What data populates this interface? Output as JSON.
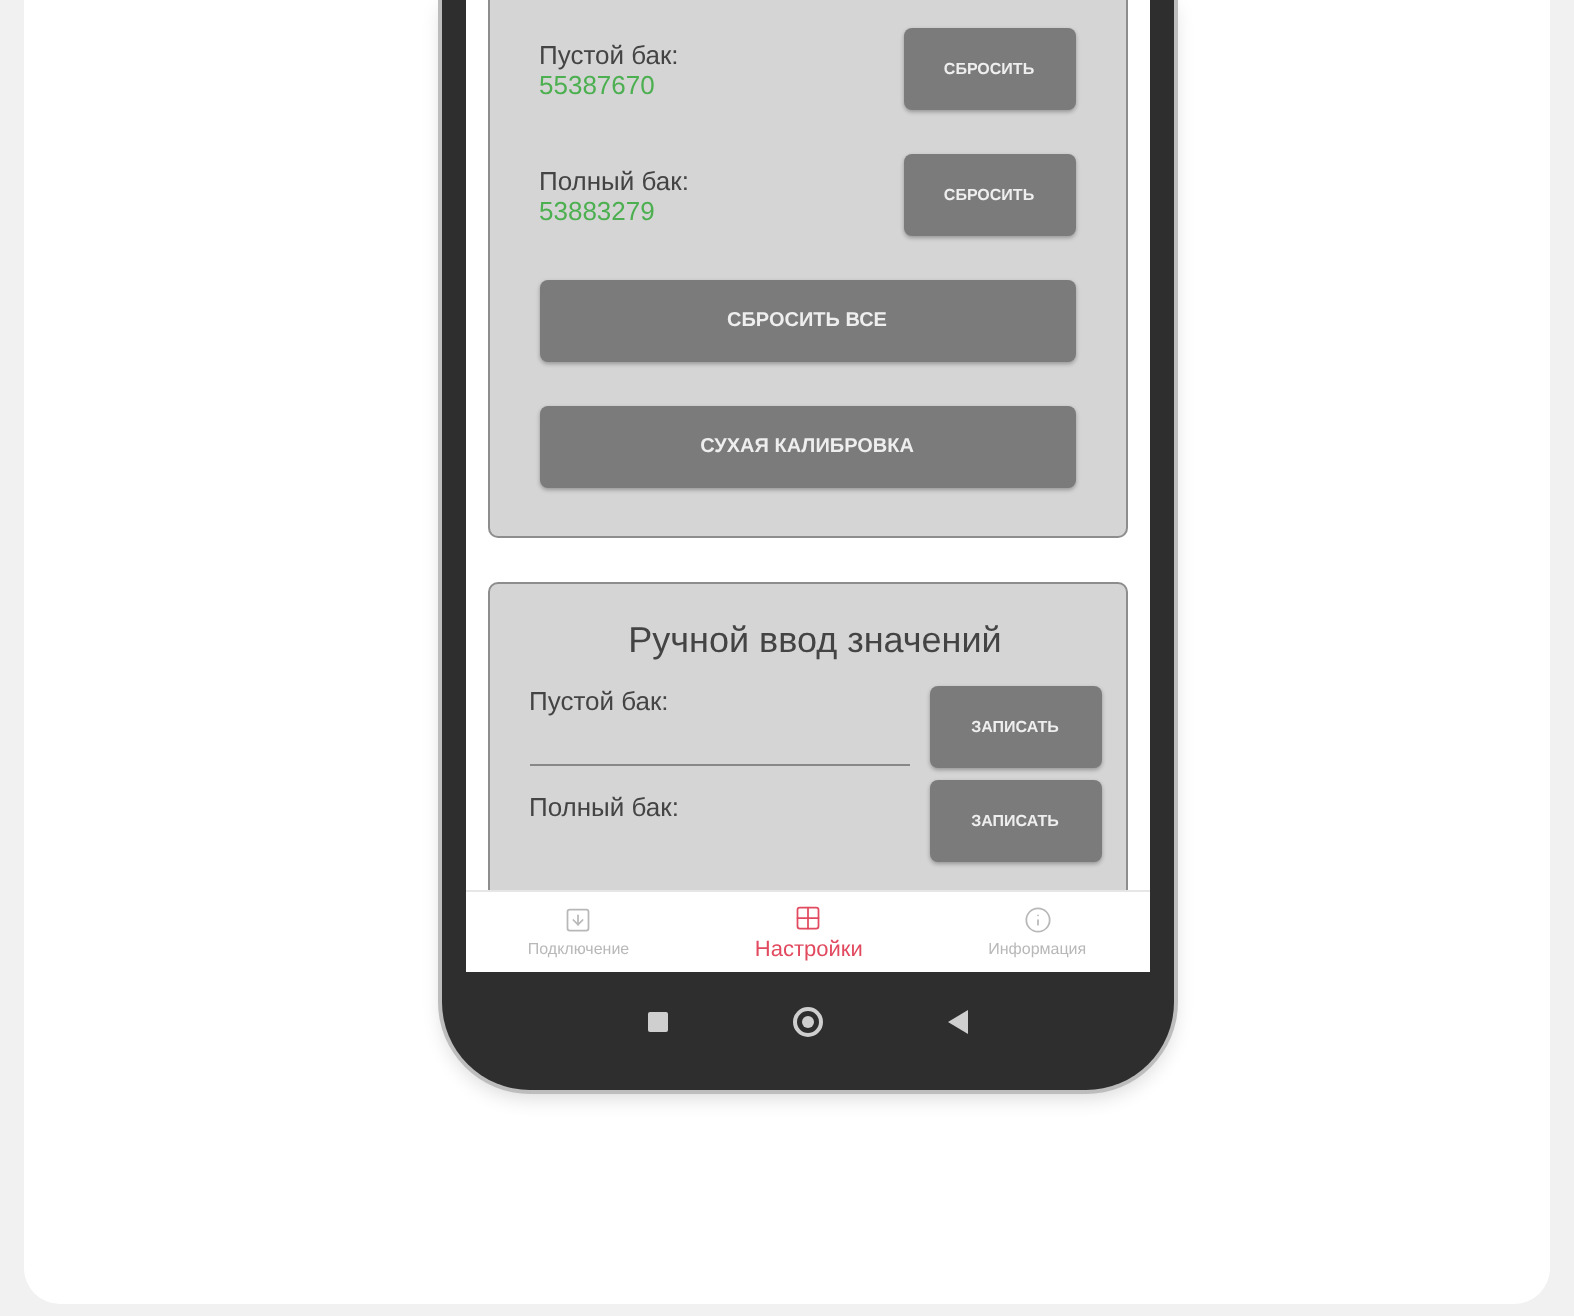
{
  "calibration": {
    "rows": [
      {
        "label": "Пустой бак:",
        "value": "55387670",
        "button": "СБРОСИТЬ"
      },
      {
        "label": "Полный бак:",
        "value": "53883279",
        "button": "СБРОСИТЬ"
      }
    ],
    "actions": [
      "СБРОСИТЬ ВСЕ",
      "СУХАЯ КАЛИБРОВКА"
    ]
  },
  "manual_entry": {
    "title": "Ручной ввод значений",
    "rows": [
      {
        "label": "Пустой бак:",
        "button": "ЗАПИСАТЬ",
        "kind": "field"
      },
      {
        "label": "Полный бак:",
        "button": "ЗАПИСАТЬ",
        "kind": "cut"
      }
    ]
  },
  "tabs": [
    {
      "label": "Подключение",
      "selected": false,
      "kind": "connect"
    },
    {
      "label": "Настройки",
      "selected": true,
      "kind": "settings"
    },
    {
      "label": "Информация",
      "selected": false,
      "kind": "info"
    }
  ]
}
